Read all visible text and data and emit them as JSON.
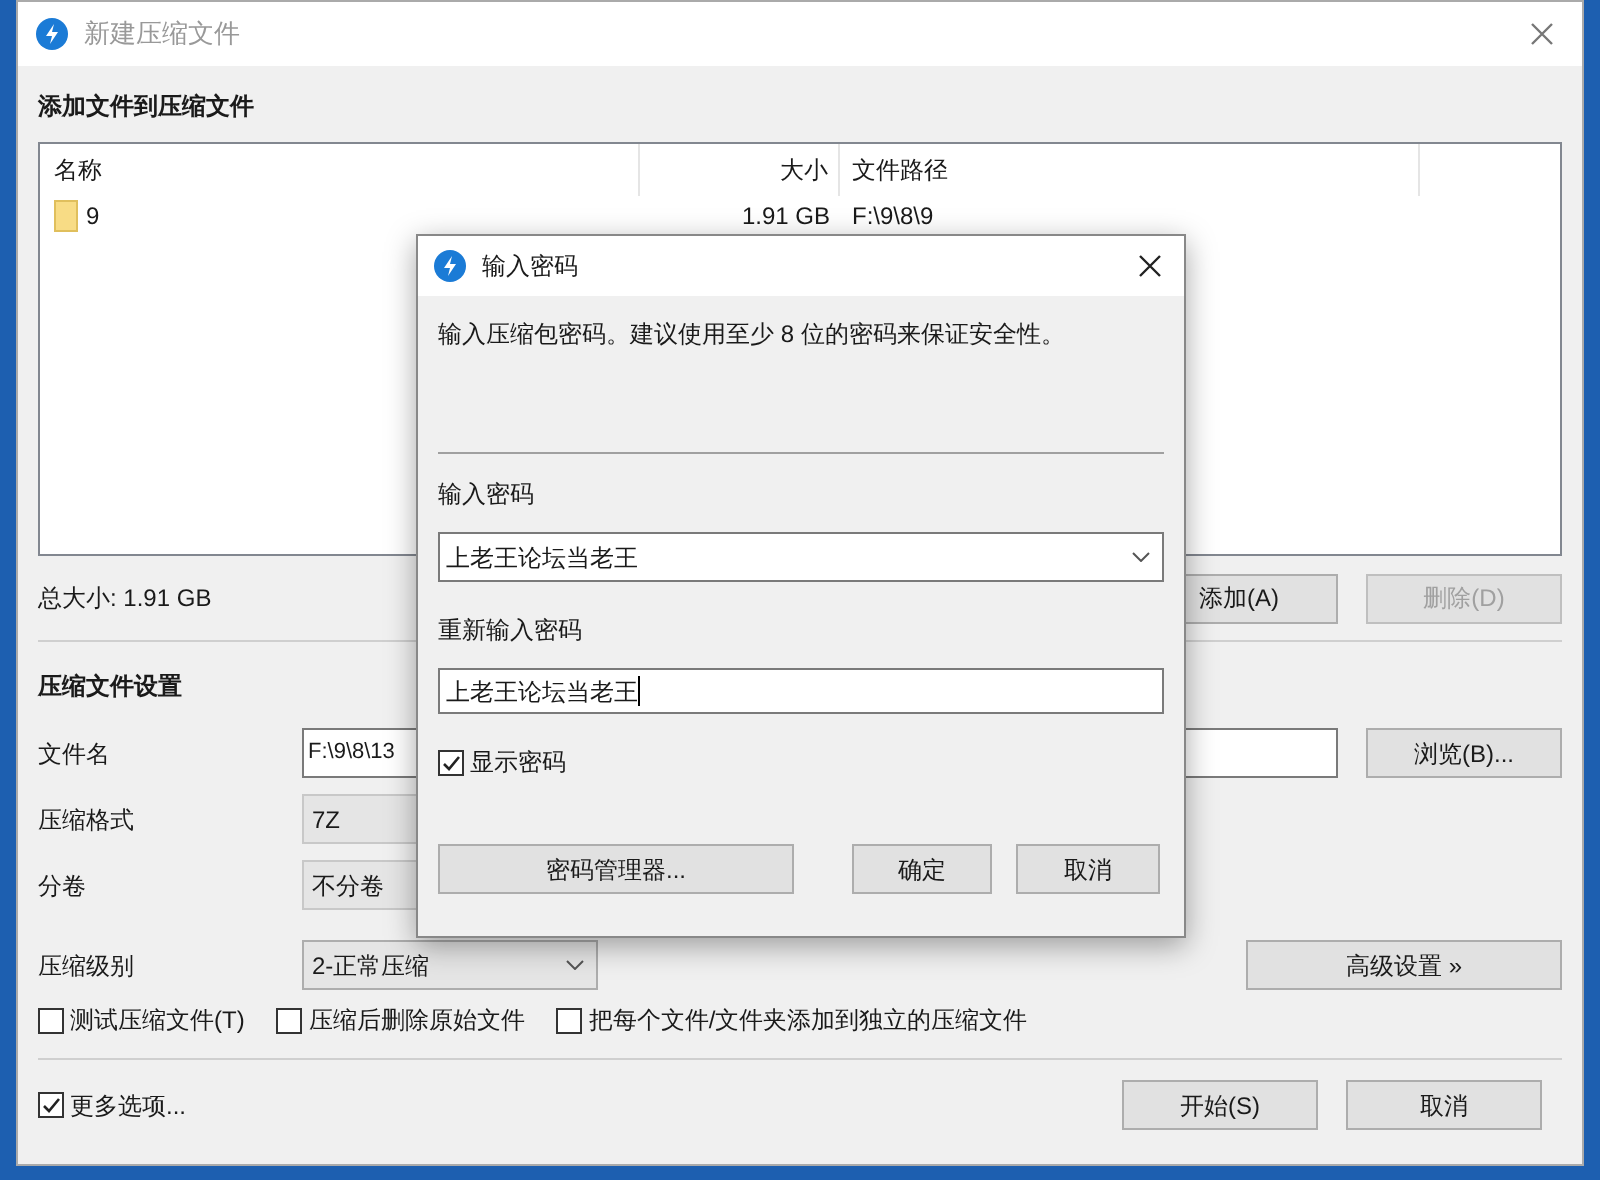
{
  "main_window": {
    "title": "新建压缩文件",
    "section_files": "添加文件到压缩文件",
    "file_list": {
      "columns": [
        "名称",
        "大小",
        "文件路径"
      ],
      "rows": [
        {
          "name": "9",
          "size": "1.91 GB",
          "path": "F:\\9\\8\\9"
        }
      ]
    },
    "total_size": "总大小: 1.91 GB",
    "add_button": "添加(A)",
    "delete_button": {
      "label": "删除(D)",
      "disabled": true
    },
    "section_settings": "压缩文件设置",
    "fields": [
      {
        "kind": "text",
        "label": "文件名",
        "value": "F:\\9\\8\\13",
        "button": "浏览(B)..."
      },
      {
        "kind": "combo",
        "label": "压缩格式",
        "value": "7Z"
      },
      {
        "kind": "combo",
        "label": "分卷",
        "value": "不分卷"
      },
      {
        "kind": "dropdown",
        "label": "压缩级别",
        "value": "2-正常压缩",
        "button": "高级设置 »"
      }
    ],
    "options": [
      {
        "label": "测试压缩文件(T)",
        "checked": false
      },
      {
        "label": "压缩后删除原始文件",
        "checked": false
      },
      {
        "label": "把每个文件/文件夹添加到独立的压缩文件",
        "checked": false
      }
    ],
    "more_options": {
      "label": "更多选项...",
      "checked": true
    },
    "buttons": [
      "开始(S)",
      "取消"
    ]
  },
  "password_dialog": {
    "title": "输入密码",
    "message": "输入压缩包密码。建议使用至少 8 位的密码来保证安全性。",
    "password_label": "输入密码",
    "password_value": "上老王论坛当老王",
    "confirm_label": "重新输入密码",
    "confirm_value": "上老王论坛当老王",
    "show_password": {
      "label": "显示密码",
      "checked": true
    },
    "buttons": [
      "密码管理器...",
      "确定",
      "取消"
    ]
  }
}
